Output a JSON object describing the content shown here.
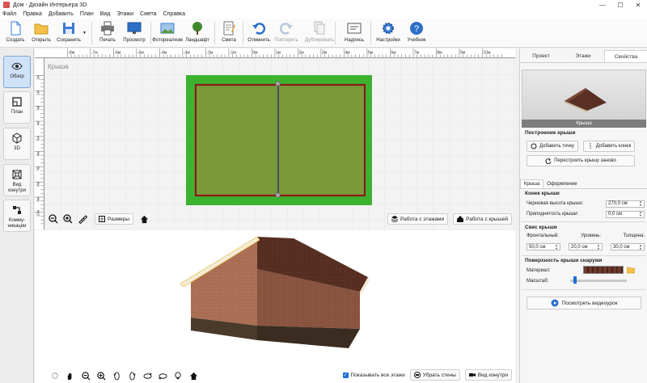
{
  "window": {
    "title": "Дом - Дизайн Интерьера 3D",
    "controls": [
      "—",
      "☐",
      "✕"
    ]
  },
  "menu": [
    "Файл",
    "Правка",
    "Добавить",
    "План",
    "Вид",
    "Этажи",
    "Смета",
    "Справка"
  ],
  "toolbar": {
    "create": "Создать",
    "open": "Открыть",
    "save": "Сохранить",
    "print": "Печать",
    "preview": "Просмотр",
    "photo": "Фотореализм",
    "landscape": "Ландшафт",
    "estimate": "Смета",
    "undo": "Отменить",
    "redo": "Повторить",
    "duplicate": "Дублировать",
    "caption": "Надпись",
    "settings": "Настройки",
    "tutorial": "Учебник"
  },
  "leftbar": [
    {
      "label": "Обзор"
    },
    {
      "label": "План"
    },
    {
      "label": "3D"
    },
    {
      "label": "Вид изнутри"
    },
    {
      "label": "Комму- никации"
    }
  ],
  "plan": {
    "label": "Крыша",
    "ruler_top": [
      "-8м",
      "-7м",
      "-6м",
      "-5м",
      "-4м",
      "-3м",
      "-2м",
      "-1м",
      "0м",
      "1м",
      "2м",
      "3м",
      "4м",
      "5м",
      "6м",
      "7м",
      "8м",
      "9м",
      "10м"
    ],
    "ruler_left": [
      "1м",
      "2м",
      "3м",
      "4м",
      "5м",
      "6м",
      "7м",
      "8м",
      "9м",
      "10м"
    ],
    "sizes_btn": "Размеры",
    "floors_btn": "Работа с этажами",
    "roof_btn": "Работа с крышей",
    "colors": {
      "lawn": "#3db22f",
      "roof": "#7a9a3a",
      "edge": "#8b1a1a"
    }
  },
  "view3d": {
    "show_floors": "Показывать все этажи",
    "hide_walls_btn": "Убрать стены",
    "inside_btn": "Вид изнутри"
  },
  "rpanel": {
    "tabs": [
      "Проект",
      "Этажи",
      "Свойства"
    ],
    "preview_caption": "Крыша",
    "build_header": "Построение крыши",
    "add_point": "Добавить точку",
    "add_ridge": "Добавить конек",
    "rebuild": "Перестроить крышу заново",
    "subtabs": [
      "Крыша",
      "Оформление"
    ],
    "ridge_header": "Конек крыши",
    "draft_height_label": "Черновая высота крыши:",
    "draft_height_value": "270,0 см",
    "raise_label": "Приподнятость крыши:",
    "raise_value": "0,0 см",
    "overhang_header": "Свес крыши",
    "front_label": "Фронтальный:",
    "front_value": "50,0 см",
    "level_label": "Уровень:",
    "level_value": "20,0 см",
    "thick_label": "Толщина:",
    "thick_value": "30,0 см",
    "surface_header": "Поверхность крыши снаружи",
    "material_label": "Материал:",
    "scale_label": "Масштаб:",
    "scale_fraction": 0.1,
    "video_btn": "Посмотреть видеоурок"
  }
}
